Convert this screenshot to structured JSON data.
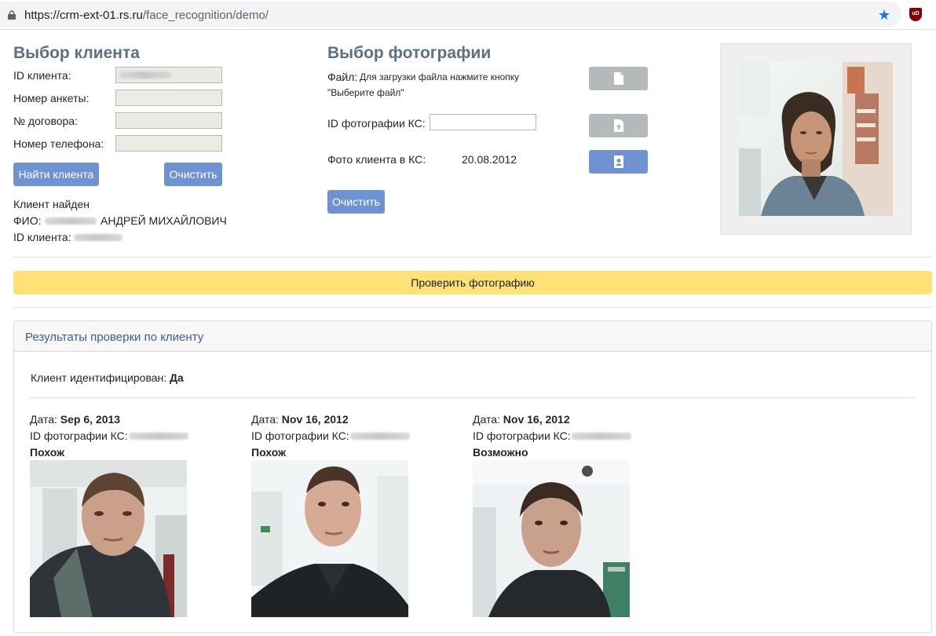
{
  "browser": {
    "url_host": "https://crm-ext-01.rs.ru",
    "url_path": "/face_recognition/demo/",
    "ext_label": "uD"
  },
  "client_select": {
    "title": "Выбор клиента",
    "labels": {
      "client_id": "ID клиента:",
      "form_number": "Номер анкеты:",
      "contract": "№ договора:",
      "phone": "Номер телефона:"
    },
    "find_button": "Найти клиента",
    "clear_button": "Очистить",
    "found_text": "Клиент найден",
    "fio_label": "ФИО:",
    "fio_value": "АНДРЕЙ МИХАЙЛОВИЧ",
    "client_id_label": "ID клиента:"
  },
  "photo_select": {
    "title": "Выбор фотографии",
    "file_label": "Файл:",
    "file_hint_1": "Для загрузки файла нажмите кнопку",
    "file_hint_2": "\"Выберите файл\"",
    "photo_id_label": "ID фотографии КС:",
    "photo_id_value": "",
    "ks_photo_label": "Фото клиента в КС:",
    "ks_photo_date": "20.08.2012",
    "clear_button": "Очистить",
    "icons": [
      "file-icon",
      "upload-icon",
      "contact-card-icon"
    ]
  },
  "verify_button": "Проверить фотографию",
  "results": {
    "title": "Результаты проверки по клиенту",
    "identified_label": "Клиент идентифицирован:",
    "identified_value": "Да",
    "items": [
      {
        "date_label": "Дата:",
        "date": "Sep 6, 2013",
        "id_label": "ID фотографии КС:",
        "verdict": "Похож"
      },
      {
        "date_label": "Дата:",
        "date": "Nov 16, 2012",
        "id_label": "ID фотографии КС:",
        "verdict": "Похож"
      },
      {
        "date_label": "Дата:",
        "date": "Nov 16, 2012",
        "id_label": "ID фотографии КС:",
        "verdict": "Возможно"
      }
    ]
  },
  "colors": {
    "heading": "#5a7085",
    "primary_button": "#6f93d2",
    "disabled_button": "#b6b9bc",
    "verify_button": "#ffe177",
    "card_title": "#3f59a8"
  }
}
